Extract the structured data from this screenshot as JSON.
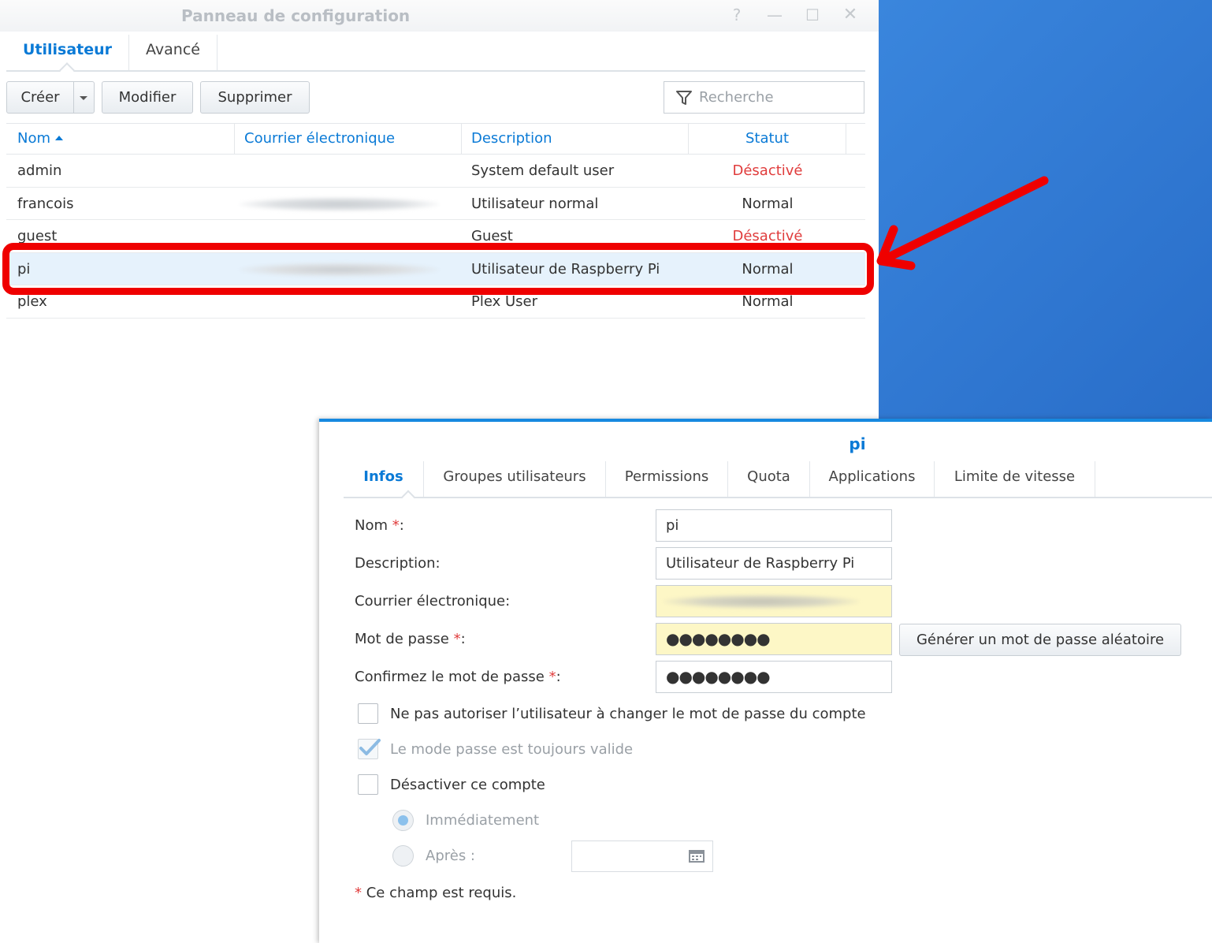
{
  "window": {
    "title": "Panneau de configuration",
    "controls": [
      "?",
      "—",
      "☐",
      "✕"
    ]
  },
  "main_tabs": [
    {
      "label": "Utilisateur",
      "active": true
    },
    {
      "label": "Avancé",
      "active": false
    }
  ],
  "toolbar": {
    "create_label": "Créer",
    "modify_label": "Modifier",
    "delete_label": "Supprimer",
    "search_placeholder": "Recherche"
  },
  "table": {
    "columns": [
      "Nom",
      "Courrier électronique",
      "Description",
      "Statut"
    ],
    "rows": [
      {
        "name": "admin",
        "email": "",
        "description": "System default user",
        "status": "Désactivé"
      },
      {
        "name": "francois",
        "email": "",
        "description": "Utilisateur normal",
        "status": "Normal"
      },
      {
        "name": "guest",
        "email": "",
        "description": "Guest",
        "status": "Désactivé"
      },
      {
        "name": "pi",
        "email": "",
        "description": "Utilisateur de Raspberry Pi",
        "status": "Normal"
      },
      {
        "name": "plex",
        "email": "",
        "description": "Plex User",
        "status": "Normal"
      }
    ]
  },
  "dialog": {
    "title": "pi",
    "tabs": [
      "Infos",
      "Groupes utilisateurs",
      "Permissions",
      "Quota",
      "Applications",
      "Limite de vitesse"
    ],
    "fields": {
      "name_label": "Nom",
      "name_value": "pi",
      "description_label": "Description:",
      "description_value": "Utilisateur de Raspberry Pi",
      "email_label": "Courrier électronique:",
      "password_label": "Mot de passe",
      "password_value": "●●●●●●●●",
      "confirm_label": "Confirmez le mot de passe",
      "confirm_value": "●●●●●●●●"
    },
    "generate_button": "Générer un mot de passe aléatoire",
    "options": {
      "no_change_pw": "Ne pas autoriser l’utilisateur à changer le mot de passe du compte",
      "pw_always_valid": "Le mode passe est toujours valide",
      "disable_account": "Désactiver ce compte",
      "immediately": "Immédiatement",
      "after": "Après :"
    },
    "required_note": "Ce champ est requis."
  },
  "colors": {
    "accent": "#0a7ad6",
    "disabled_status": "#e03c3c",
    "highlight": "#ef0000",
    "desktop": "#2f7bd3"
  }
}
